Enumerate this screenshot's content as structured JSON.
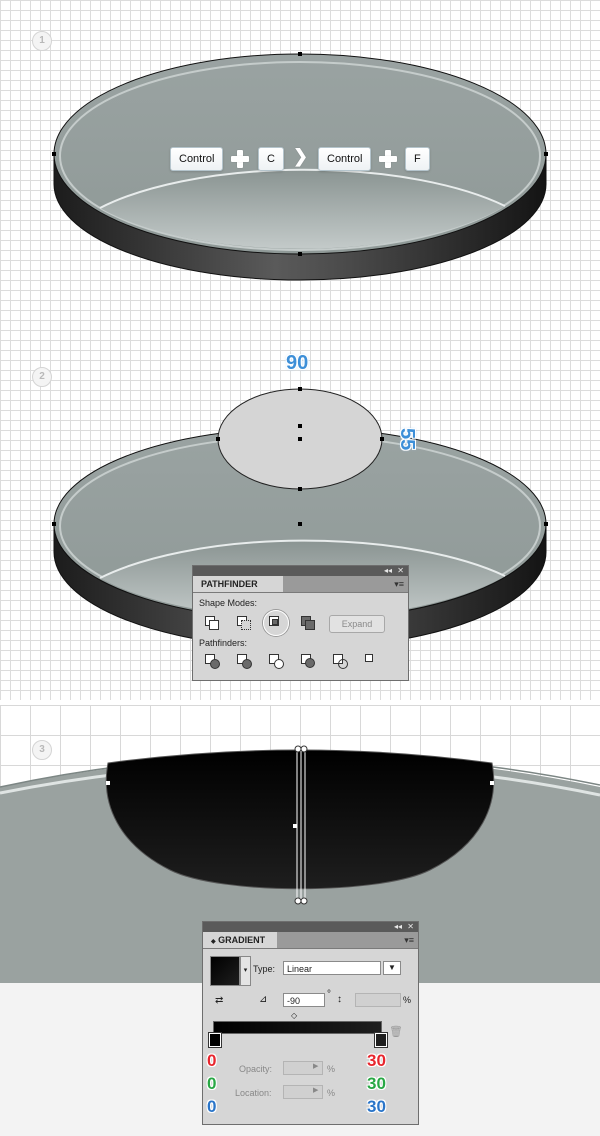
{
  "steps": {
    "one": "1",
    "two": "2",
    "three": "3"
  },
  "shortcut": {
    "key1": "Control",
    "key2": "C",
    "key3": "Control",
    "key4": "F"
  },
  "dimensions": {
    "width": "90",
    "height": "55"
  },
  "pathfinder": {
    "title": "PATHFINDER",
    "menu_icon": "panel-menu-icon",
    "shape_modes_label": "Shape Modes:",
    "pathfinders_label": "Pathfinders:",
    "expand_label": "Expand",
    "topbar_collapse": "◂◂",
    "topbar_close": "✕"
  },
  "gradient": {
    "title": "GRADIENT",
    "tab_arrow": "◆",
    "type_label": "Type:",
    "type_value": "Linear",
    "angle_value": "-90",
    "degree_symbol": "°",
    "percent_symbol": "%",
    "opacity_label": "Opacity:",
    "location_label": "Location:",
    "topbar_collapse": "◂◂",
    "topbar_close": "✕",
    "rgb_left": {
      "r": "0",
      "g": "0",
      "b": "0"
    },
    "rgb_right": {
      "r": "30",
      "g": "30",
      "b": "30"
    }
  },
  "colors": {
    "red": "#e8262e",
    "green": "#29a845",
    "blue": "#2a75c9",
    "dimension_blue": "#3d8fd8"
  }
}
